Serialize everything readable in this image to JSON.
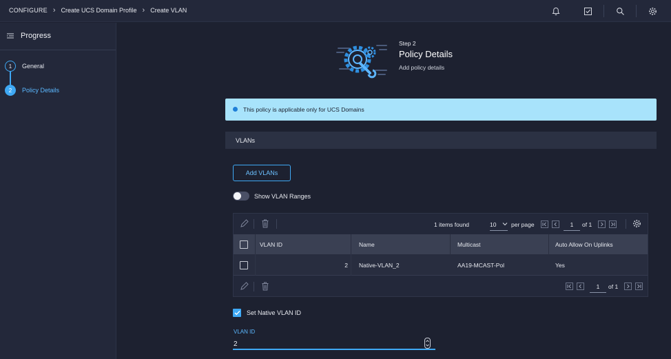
{
  "breadcrumbs": [
    "CONFIGURE",
    "Create UCS Domain Profile",
    "Create VLAN"
  ],
  "topbar_icons": [
    "bell-icon",
    "task-check-icon",
    "search-icon",
    "settings-gear-icon"
  ],
  "sidebar": {
    "title": "Progress",
    "steps": [
      {
        "number": "1",
        "label": "General"
      },
      {
        "number": "2",
        "label": "Policy Details"
      }
    ]
  },
  "header": {
    "step": "Step 2",
    "title": "Policy Details",
    "description": "Add policy details"
  },
  "info_banner": "This policy is applicable only for UCS Domains",
  "section_title": "VLANs",
  "add_vlans_label": "Add VLANs",
  "show_ranges_label": "Show VLAN Ranges",
  "show_ranges_on": false,
  "table": {
    "items_found": "1 items found",
    "per_page_value": "10",
    "per_page_label": "per page",
    "page": "1",
    "of_pages": "of 1",
    "columns": [
      "VLAN ID",
      "Name",
      "Multicast",
      "Auto Allow On Uplinks"
    ],
    "rows": [
      {
        "vlan_id": "2",
        "name": "Native-VLAN_2",
        "multicast": "AA19-MCAST-Pol",
        "auto_allow": "Yes"
      }
    ]
  },
  "native_vlan": {
    "checkbox_label": "Set Native VLAN ID",
    "checked": true,
    "field_label": "VLAN ID",
    "value": "2"
  },
  "colors": {
    "accent": "#3fa9f5",
    "info_bg": "#a8e3fb",
    "background": "#1d2130"
  }
}
